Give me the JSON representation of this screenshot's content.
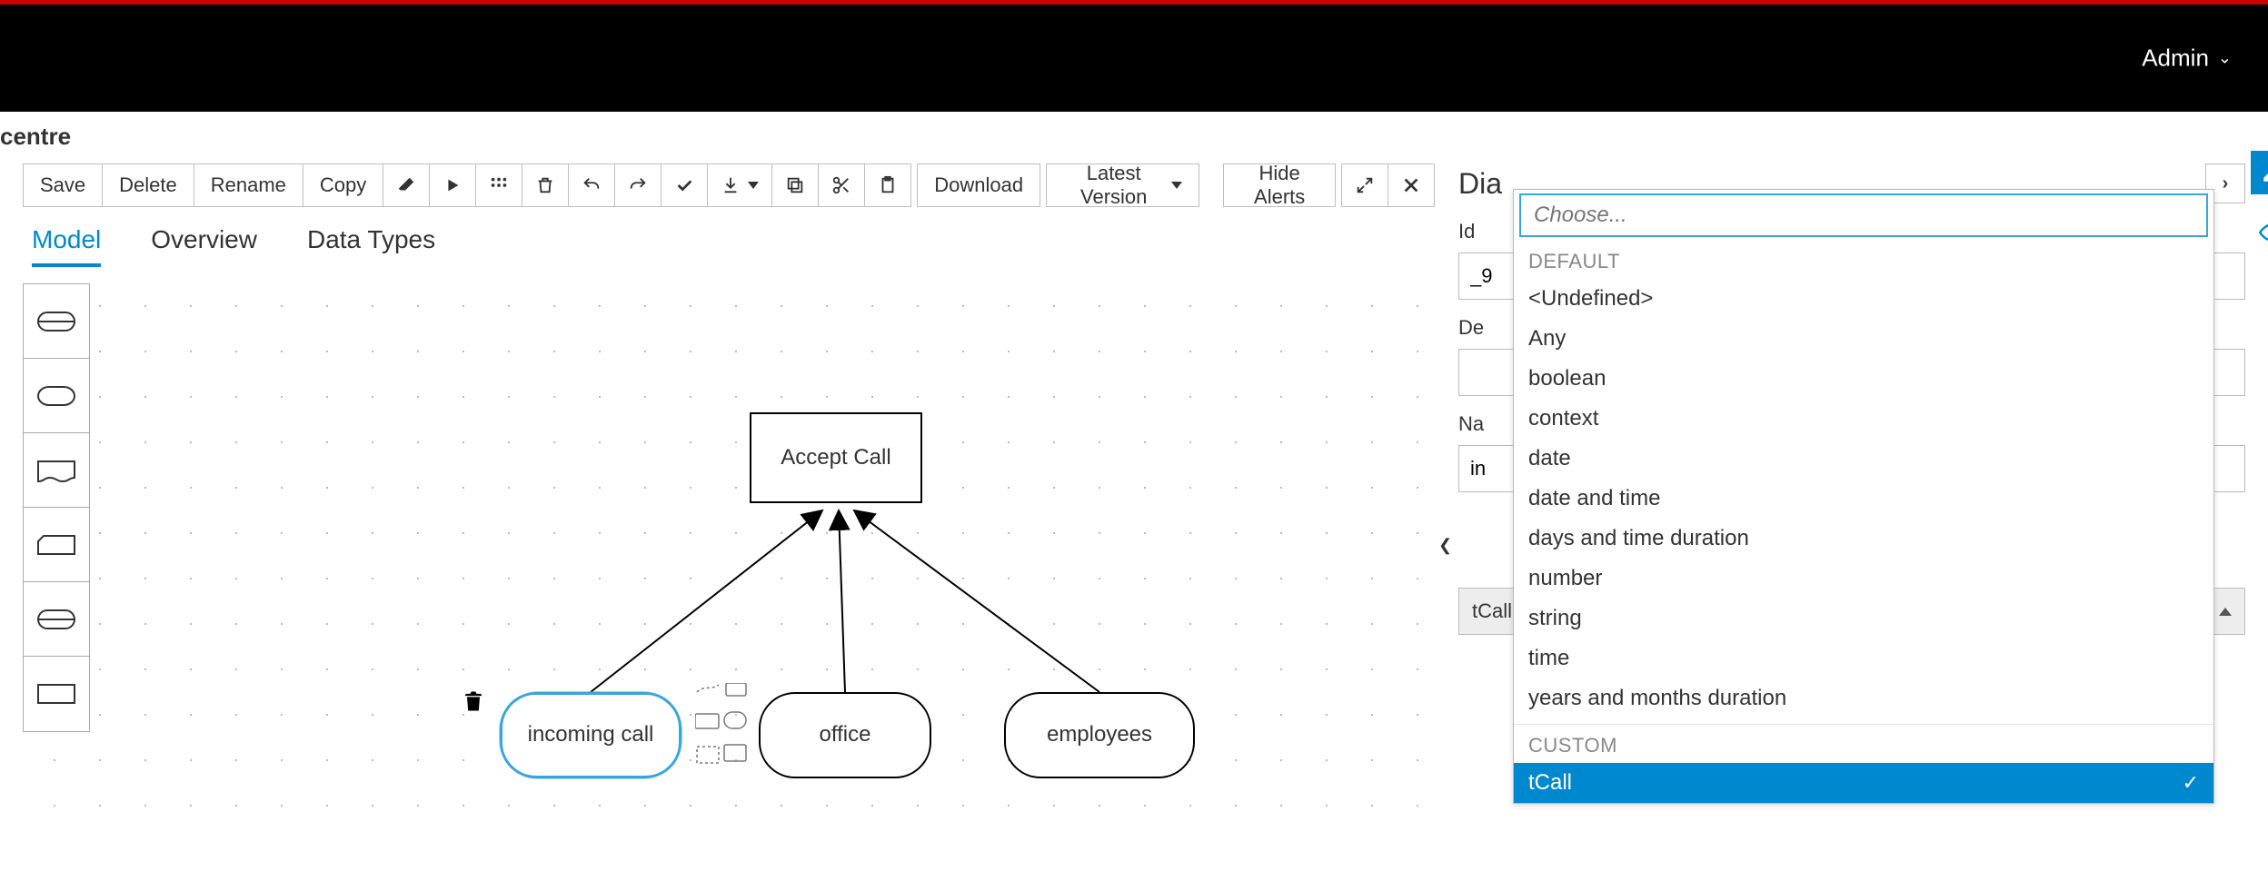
{
  "header": {
    "admin_label": "Admin"
  },
  "breadcrumb": "centre",
  "toolbar": {
    "save": "Save",
    "delete": "Delete",
    "rename": "Rename",
    "copy": "Copy",
    "download": "Download",
    "latest_version": "Latest Version",
    "hide_alerts": "Hide Alerts"
  },
  "tabs": {
    "model": "Model",
    "overview": "Overview",
    "data_types": "Data Types"
  },
  "diagram": {
    "decision": "Accept Call",
    "inputs": [
      "incoming call",
      "office",
      "employees"
    ]
  },
  "properties": {
    "title_prefix": "Dia",
    "id_label": "Id",
    "id_value": "_9",
    "description_label": "De",
    "description_value": "",
    "name_label": "Na",
    "name_value": "in",
    "data_type_value": "tCall"
  },
  "dropdown": {
    "placeholder": "Choose...",
    "group_default": "DEFAULT",
    "group_custom": "CUSTOM",
    "default_options": [
      "<Undefined>",
      "Any",
      "boolean",
      "context",
      "date",
      "date and time",
      "days and time duration",
      "number",
      "string",
      "time",
      "years and months duration"
    ],
    "custom_options": [
      "tCall"
    ],
    "selected": "tCall"
  }
}
